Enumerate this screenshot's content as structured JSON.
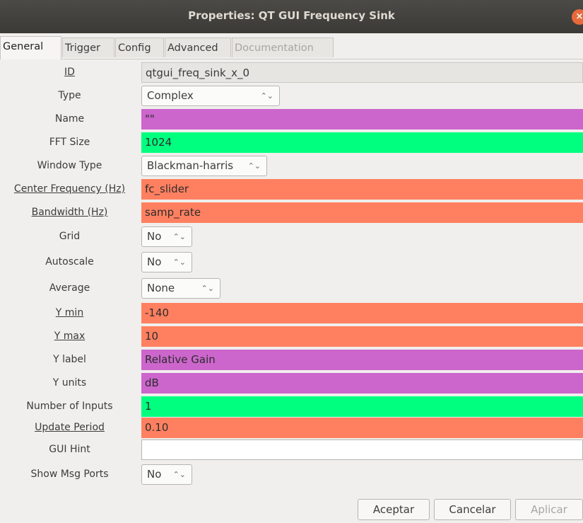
{
  "window": {
    "title": "Properties: QT GUI Frequency Sink",
    "close_glyph": "×"
  },
  "tabs": [
    {
      "label": "General",
      "state": "active"
    },
    {
      "label": "Trigger",
      "state": "normal"
    },
    {
      "label": "Config",
      "state": "normal"
    },
    {
      "label": "Advanced",
      "state": "normal"
    },
    {
      "label": "Documentation",
      "state": "disabled"
    }
  ],
  "properties": [
    {
      "label": "ID",
      "value": "qtgui_freq_sink_x_0",
      "kind": "text",
      "color": "#e6e5e2",
      "underline": true
    },
    {
      "label": "Type",
      "value": "Complex",
      "kind": "combo"
    },
    {
      "label": "Name",
      "value": "\"\"",
      "kind": "text",
      "color": "#cc66cc"
    },
    {
      "label": "FFT Size",
      "value": "1024",
      "kind": "text",
      "color": "#00ff7f"
    },
    {
      "label": "Window Type",
      "value": "Blackman-harris",
      "kind": "combo"
    },
    {
      "label": "Center Frequency (Hz)",
      "value": "fc_slider",
      "kind": "text",
      "color": "#ff8060",
      "underline": true
    },
    {
      "label": "Bandwidth (Hz)",
      "value": "samp_rate",
      "kind": "text",
      "color": "#ff8060",
      "underline": true
    },
    {
      "label": "Grid",
      "value": "No",
      "kind": "combo"
    },
    {
      "label": "Autoscale",
      "value": "No",
      "kind": "combo"
    },
    {
      "label": "Average",
      "value": "None",
      "kind": "combo"
    },
    {
      "label": "Y min",
      "value": "-140",
      "kind": "text",
      "color": "#ff8060",
      "underline": true
    },
    {
      "label": "Y max",
      "value": "10",
      "kind": "text",
      "color": "#ff8060",
      "underline": true
    },
    {
      "label": "Y label",
      "value": "Relative Gain",
      "kind": "text",
      "color": "#cc66cc"
    },
    {
      "label": "Y units",
      "value": "dB",
      "kind": "text",
      "color": "#cc66cc"
    },
    {
      "label": "Number of Inputs",
      "value": "1",
      "kind": "text",
      "color": "#00ff7f"
    },
    {
      "label": "Update Period",
      "value": "0.10",
      "kind": "text",
      "color": "#ff8060",
      "underline": true
    },
    {
      "label": "GUI Hint",
      "value": "",
      "kind": "text",
      "color": "#ffffff"
    },
    {
      "label": "Show Msg Ports",
      "value": "No",
      "kind": "combo"
    }
  ],
  "combo_arrow_glyph": "⌃⌄",
  "buttons": {
    "accept": "Aceptar",
    "cancel": "Cancelar",
    "apply": "Aplicar"
  }
}
